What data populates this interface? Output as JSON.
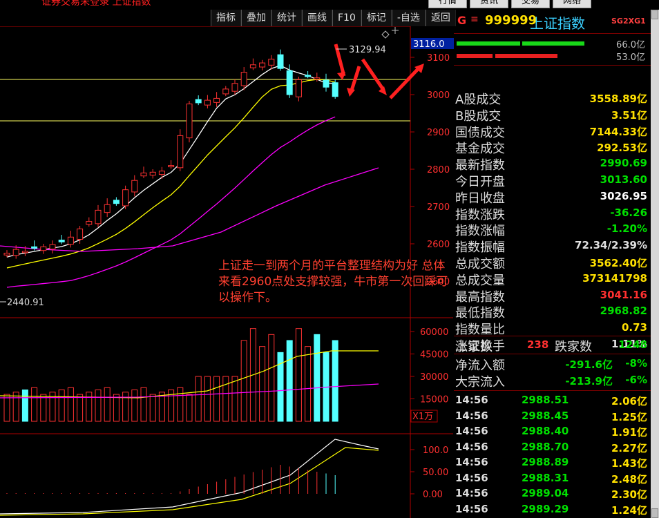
{
  "window": {
    "title": "证券交易未登录 上证指数",
    "tabs": [
      "行情",
      "资讯",
      "交易",
      "网络"
    ]
  },
  "toolbar": [
    "指标",
    "叠加",
    "统计",
    "画线",
    "F10",
    "标记",
    "-自选",
    "返回"
  ],
  "chart": {
    "price_axis": [
      "3100",
      "3000",
      "2900",
      "2800",
      "2700",
      "2600",
      "2500"
    ],
    "price_cursor": "3116.0",
    "high_label": "3129.94",
    "low_label": "2440.91",
    "volume_axis": [
      "60000",
      "45000",
      "30000",
      "15000"
    ],
    "volume_unit": "X1万",
    "macd_axis": [
      "100.0",
      "50.00",
      "0.00"
    ],
    "annotation_text": "上证走一到两个月的平台整理结构为好 总体来看2960点处支撑较强，牛市第一次回踩可以操作下。",
    "colors": {
      "up": "#ff3232",
      "down": "#54ffff",
      "ma5": "#ffffff",
      "ma10": "#ffff00",
      "ma20": "#ff00ff"
    }
  },
  "header": {
    "prefix": "G",
    "menu_icon": "≡",
    "code": "999999",
    "name": "上证指数",
    "tag": "SG2XG1"
  },
  "bars": {
    "val1": "66.0亿",
    "val2": "53.0亿"
  },
  "stats": [
    {
      "label": "A股成交",
      "value": "3558.89亿",
      "color": "#ffe000"
    },
    {
      "label": "B股成交",
      "value": "3.51亿",
      "color": "#ffe000"
    },
    {
      "label": "国债成交",
      "value": "7144.33亿",
      "color": "#ffe000"
    },
    {
      "label": "基金成交",
      "value": "292.53亿",
      "color": "#ffe000"
    },
    {
      "label": "最新指数",
      "value": "2990.69",
      "color": "#00e000"
    },
    {
      "label": "今日开盘",
      "value": "3013.60",
      "color": "#00e000"
    },
    {
      "label": "昨日收盘",
      "value": "3026.95",
      "color": "#ffffff"
    },
    {
      "label": "指数涨跌",
      "value": "-36.26",
      "color": "#00e000"
    },
    {
      "label": "指数涨幅",
      "value": "-1.20%",
      "color": "#00e000"
    },
    {
      "label": "指数振幅",
      "value": "72.34/2.39%",
      "color": "#e0e0e0"
    },
    {
      "label": "总成交额",
      "value": "3562.40亿",
      "color": "#ffe000"
    },
    {
      "label": "总成交量",
      "value": "373141798",
      "color": "#ffe000"
    },
    {
      "label": "最高指数",
      "value": "3041.16",
      "color": "#ff3030"
    },
    {
      "label": "最低指数",
      "value": "2968.82",
      "color": "#00e000"
    },
    {
      "label": "指数量比",
      "value": "0.73",
      "color": "#ffe000"
    },
    {
      "label": "上证换手",
      "value": "1.11%",
      "color": "#e0e0e0"
    }
  ],
  "breadth": {
    "up_label": "涨家数",
    "up_value": "238",
    "down_label": "跌家数",
    "down_value": "1248"
  },
  "flows": [
    {
      "label": "净流入额",
      "value": "-291.6亿",
      "pct": "-8%"
    },
    {
      "label": "大宗流入",
      "value": "-213.9亿",
      "pct": "-6%"
    }
  ],
  "ticks": [
    {
      "time": "14:56",
      "price": "2988.51",
      "amount": "2.06亿"
    },
    {
      "time": "14:56",
      "price": "2988.45",
      "amount": "1.25亿"
    },
    {
      "time": "14:56",
      "price": "2988.40",
      "amount": "1.91亿"
    },
    {
      "time": "14:56",
      "price": "2988.70",
      "amount": "2.27亿"
    },
    {
      "time": "14:56",
      "price": "2988.89",
      "amount": "1.43亿"
    },
    {
      "time": "14:56",
      "price": "2988.31",
      "amount": "2.48亿"
    },
    {
      "time": "14:56",
      "price": "2989.04",
      "amount": "2.30亿"
    },
    {
      "time": "14:56",
      "price": "2989.29",
      "amount": "1.24亿"
    }
  ]
}
